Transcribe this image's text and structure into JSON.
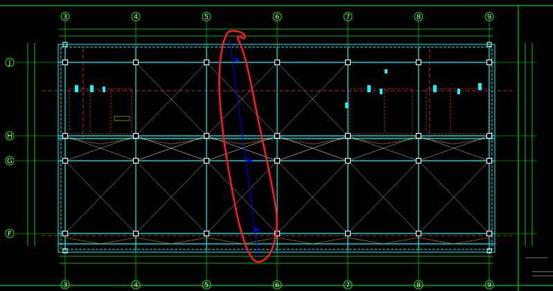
{
  "drawing": {
    "grid_columns": [
      "3",
      "4",
      "5",
      "6",
      "7",
      "8",
      "9"
    ],
    "grid_rows": [
      "J",
      "H",
      "G",
      "F"
    ],
    "colors": {
      "background": "#000000",
      "grid": "#00ff00",
      "column": "#ffffff",
      "beam": "#00ffff",
      "axis": "#ff3333",
      "brace": "#ffffff",
      "member_orange": "#ff9900",
      "highlight": "#0000ff",
      "markup": "#ff1a1a",
      "text": "#ffffff",
      "note": "#ffff00"
    }
  }
}
